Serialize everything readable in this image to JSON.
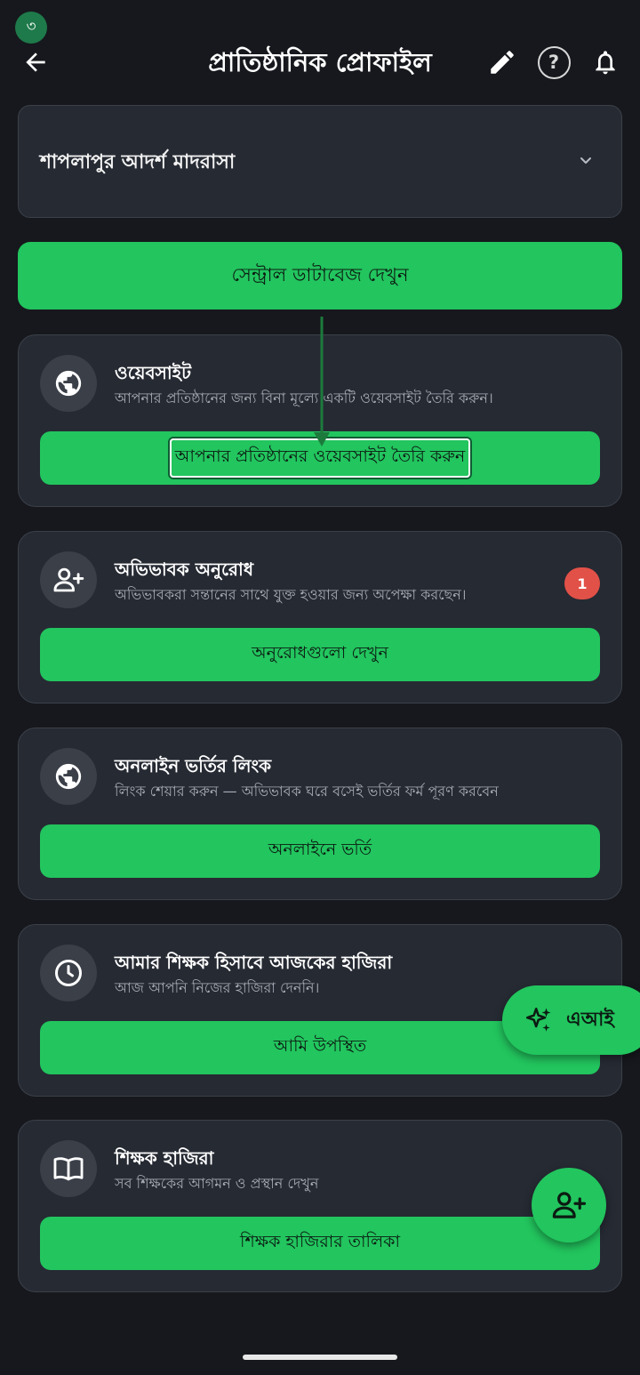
{
  "step_badge": "৩",
  "header": {
    "title": "প্রাতিষ্ঠানিক প্রোফাইল",
    "help_label": "?",
    "back_icon": "arrow-left-icon",
    "edit_icon": "pencil-icon",
    "bell_icon": "bell-icon"
  },
  "institution_select": {
    "value": "শাপলাপুর আদর্শ মাদরাসা"
  },
  "central_db_button": "সেন্ট্রাল ডাটাবেজ দেখুন",
  "cards": [
    {
      "icon": "globe-icon",
      "title": "ওয়েবসাইট",
      "subtitle": "আপনার প্রতিষ্ঠানের জন্য বিনা মূল্যে একটি ওয়েবসাইট তৈরি করুন।",
      "button": "আপনার প্রতিষ্ঠানের ওয়েবসাইট তৈরি করুন"
    },
    {
      "icon": "person-add-icon",
      "title": "অভিভাবক অনুরোধ",
      "subtitle": "অভিভাবকরা সন্তানের সাথে যুক্ত হওয়ার জন্য অপেক্ষা করছেন।",
      "badge": "1",
      "button": "অনুরোধগুলো দেখুন"
    },
    {
      "icon": "globe-icon",
      "title": "অনলাইন ভর্তির লিংক",
      "subtitle": "লিংক শেয়ার করুন — অভিভাবক ঘরে বসেই ভর্তির ফর্ম পূরণ করবেন",
      "button": "অনলাইনে ভর্তি"
    },
    {
      "icon": "clock-icon",
      "title": "আমার শিক্ষক হিসাবে আজকের হাজিরা",
      "subtitle": "আজ আপনি নিজের হাজিরা দেননি।",
      "button": "আমি উপস্থিত"
    },
    {
      "icon": "book-icon",
      "title": "শিক্ষক হাজিরা",
      "subtitle": "সব শিক্ষকের আগমন ও প্রস্থান দেখুন",
      "button": "শিক্ষক হাজিরার তালিকা"
    }
  ],
  "ai_fab": "এআই",
  "colors": {
    "background": "#16181d",
    "card": "#262a33",
    "accent_green": "#22c55e",
    "badge_red": "#e25148"
  }
}
